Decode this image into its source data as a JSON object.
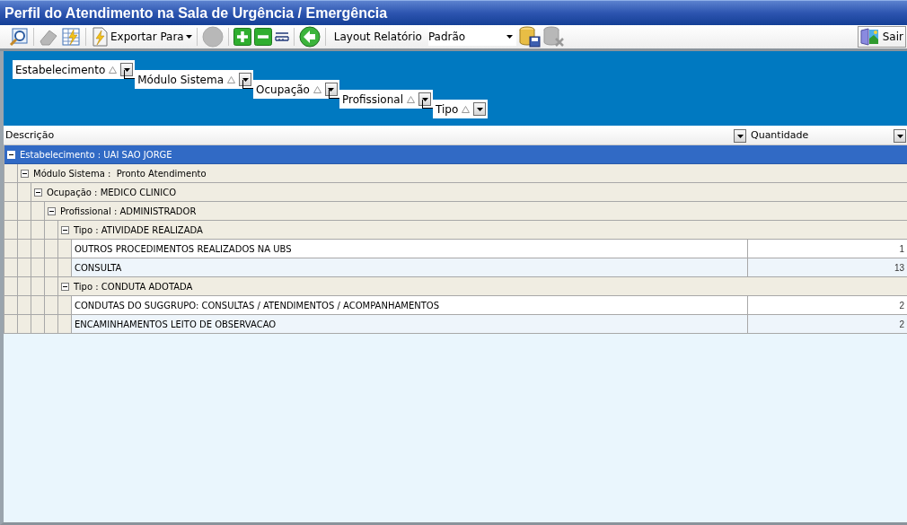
{
  "window": {
    "title": "Perfil do Atendimento na Sala de Urgência / Emergência"
  },
  "toolbar": {
    "buttons": [
      {
        "kind": "preview",
        "disabled": false
      },
      {
        "kind": "eraser",
        "disabled": true
      },
      {
        "kind": "sheet",
        "disabled": false
      },
      {
        "kind": "export",
        "disabled": false,
        "label": "Exportar Para"
      },
      {
        "kind": "ball",
        "disabled": true
      },
      {
        "kind": "plus",
        "disabled": false
      },
      {
        "kind": "minus",
        "disabled": false
      },
      {
        "kind": "ruler",
        "disabled": false
      },
      {
        "kind": "back",
        "disabled": false
      }
    ],
    "layout_label": "Layout Relatório",
    "layout_value": "Padrão",
    "storage_buttons": [
      {
        "kind": "save",
        "disabled": false
      },
      {
        "kind": "delete",
        "disabled": true
      }
    ],
    "exit_label": "Sair"
  },
  "group_panel": {
    "fields": [
      "Estabelecimento",
      "Módulo Sistema",
      "Ocupação",
      "Profissional",
      "Tipo"
    ]
  },
  "table": {
    "columns": [
      "Descrição",
      "Quantidade"
    ],
    "rows": [
      {
        "kind": "group",
        "label": "Estabelecimento : UAI SAO JORGE",
        "expanded": true,
        "selected": true,
        "children": [
          {
            "kind": "group",
            "label": "Módulo Sistema :  Pronto Atendimento",
            "expanded": true,
            "selected": false,
            "children": [
              {
                "kind": "group",
                "label": "Ocupação : MEDICO CLINICO",
                "expanded": true,
                "selected": false,
                "children": [
                  {
                    "kind": "group",
                    "label": "Profissional : ADMINISTRADOR",
                    "expanded": true,
                    "selected": false,
                    "children": [
                      {
                        "kind": "group",
                        "label": "Tipo : ATIVIDADE REALIZADA",
                        "expanded": true,
                        "selected": false,
                        "children": [
                          {
                            "kind": "row",
                            "descricao": "OUTROS PROCEDIMENTOS REALIZADOS NA UBS",
                            "quantidade": "1"
                          },
                          {
                            "kind": "row",
                            "descricao": "CONSULTA",
                            "quantidade": "13"
                          }
                        ]
                      },
                      {
                        "kind": "group",
                        "label": "Tipo : CONDUTA ADOTADA",
                        "expanded": true,
                        "selected": false,
                        "children": [
                          {
                            "kind": "row",
                            "descricao": "CONDUTAS DO SUGGRUPO: CONSULTAS / ATENDIMENTOS / ACOMPANHAMENTOS",
                            "quantidade": "2"
                          },
                          {
                            "kind": "row",
                            "descricao": "ENCAMINHAMENTOS LEITO DE OBSERVACAO",
                            "quantidade": "2"
                          }
                        ]
                      }
                    ]
                  }
                ]
              }
            ]
          }
        ]
      }
    ]
  }
}
